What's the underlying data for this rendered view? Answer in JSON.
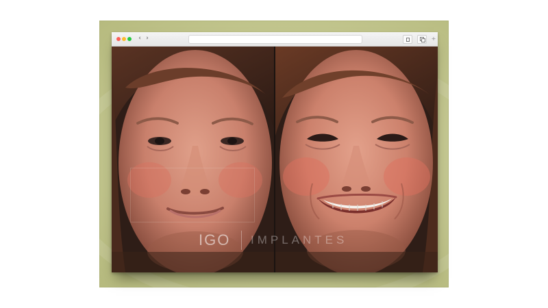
{
  "browser": {
    "nav": {
      "back_glyph": "‹",
      "forward_glyph": "›"
    },
    "toolbar_icons": [
      "share-icon",
      "tabs-icon",
      "add-tab-icon"
    ],
    "address": ""
  },
  "photos": {
    "before": {
      "subject": "woman-face-closed-smile"
    },
    "after": {
      "subject": "woman-face-open-smile"
    }
  },
  "watermark": {
    "brand": "IGO",
    "suffix": "IMPLANTES"
  },
  "colors": {
    "backdrop": "#c9cc97",
    "traffic_red": "#fc5f57",
    "traffic_yellow": "#fdbc2e",
    "traffic_green": "#28c840"
  }
}
